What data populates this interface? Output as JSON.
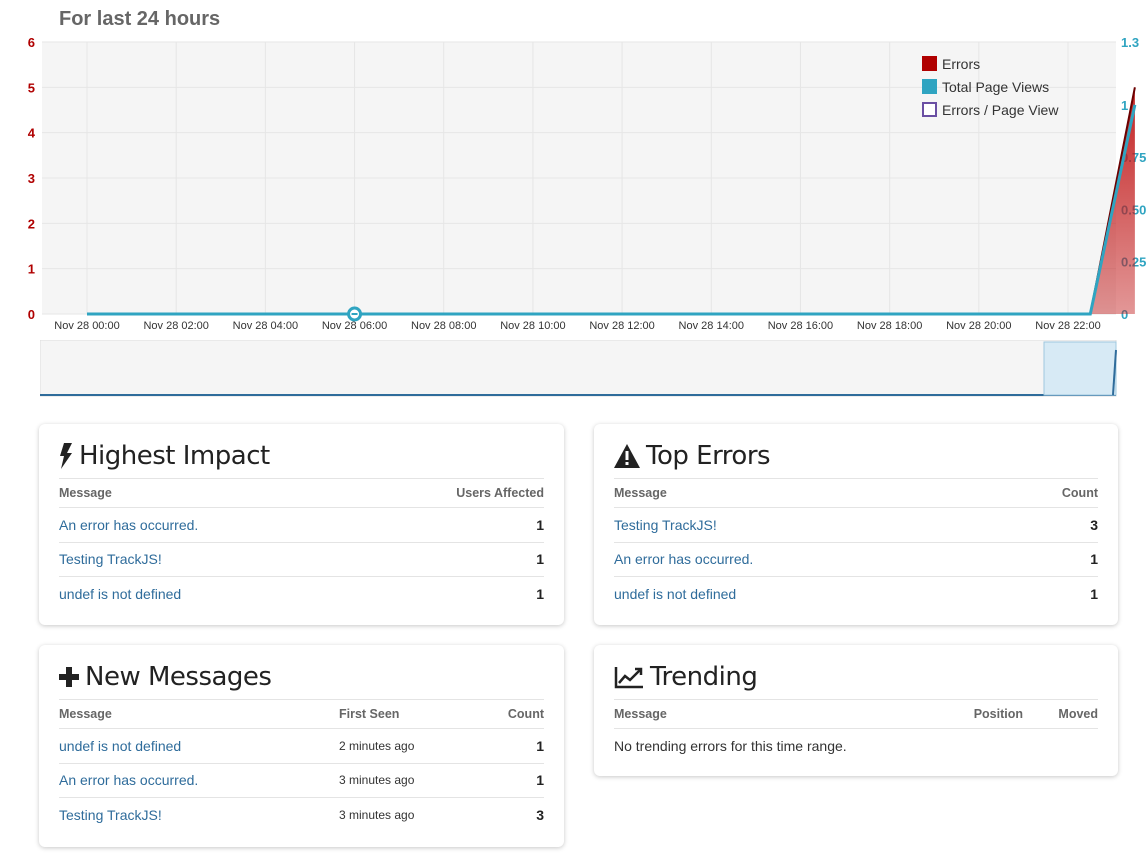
{
  "chart_title": "For last 24 hours",
  "chart_data": {
    "type": "area",
    "categories": [
      "Nov 28 00:00",
      "Nov 28 02:00",
      "Nov 28 04:00",
      "Nov 28 06:00",
      "Nov 28 08:00",
      "Nov 28 10:00",
      "Nov 28 12:00",
      "Nov 28 14:00",
      "Nov 28 16:00",
      "Nov 28 18:00",
      "Nov 28 20:00",
      "Nov 28 22:00"
    ],
    "left_axis": {
      "ticks": [
        "0",
        "1",
        "2",
        "3",
        "4",
        "5",
        "6"
      ],
      "ylim": [
        0,
        6
      ],
      "color": "#b00000"
    },
    "right_axis": {
      "ticks": [
        "0",
        "0.25",
        "0.50",
        "0.75",
        "1",
        "1.3"
      ],
      "color": "#2fa4c1"
    },
    "series": [
      {
        "name": "Errors",
        "color": "#b00000",
        "axis": "left",
        "points": [
          [
            0,
            0
          ],
          [
            22.5,
            0
          ],
          [
            23.5,
            5
          ]
        ]
      },
      {
        "name": "Total Page Views",
        "color": "#2fa4c1",
        "axis": "right",
        "points": [
          [
            0,
            0
          ],
          [
            22.5,
            0
          ],
          [
            23.5,
            1
          ]
        ]
      },
      {
        "name": "Errors / Page View",
        "color": "#6a4fa3",
        "axis": "left",
        "points": []
      }
    ],
    "marker": {
      "series": "Total Page Views",
      "x": 6,
      "y": 0
    },
    "grid": true,
    "legend": "top-right"
  },
  "cards": {
    "highest_impact": {
      "title": "Highest Impact",
      "col_message": "Message",
      "col_count": "Users Affected",
      "rows": [
        {
          "message": "An error has occurred.",
          "count": "1"
        },
        {
          "message": "Testing TrackJS!",
          "count": "1"
        },
        {
          "message": "undef is not defined",
          "count": "1"
        }
      ]
    },
    "top_errors": {
      "title": "Top Errors",
      "col_message": "Message",
      "col_count": "Count",
      "rows": [
        {
          "message": "Testing TrackJS!",
          "count": "3"
        },
        {
          "message": "An error has occurred.",
          "count": "1"
        },
        {
          "message": "undef is not defined",
          "count": "1"
        }
      ]
    },
    "new_messages": {
      "title": "New Messages",
      "col_message": "Message",
      "col_first_seen": "First Seen",
      "col_count": "Count",
      "rows": [
        {
          "message": "undef is not defined",
          "first_seen": "2 minutes ago",
          "count": "1"
        },
        {
          "message": "An error has occurred.",
          "first_seen": "3 minutes ago",
          "count": "1"
        },
        {
          "message": "Testing TrackJS!",
          "first_seen": "3 minutes ago",
          "count": "3"
        }
      ]
    },
    "trending": {
      "title": "Trending",
      "col_message": "Message",
      "col_position": "Position",
      "col_moved": "Moved",
      "empty_text": "No trending errors for this time range."
    }
  },
  "colors": {
    "link": "#2f6c9b",
    "errors": "#b00000",
    "page_views": "#2fa4c1",
    "ratio": "#6a4fa3"
  }
}
